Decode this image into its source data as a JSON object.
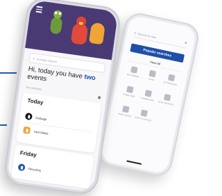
{
  "colors": {
    "accent": "#1f4fa8",
    "hero_bg": "#4a3a74",
    "garbage": "#151515",
    "yard_waste": "#e9a93a",
    "recycling": "#2456b3"
  },
  "back_phone": {
    "search_placeholder": "Search for item",
    "close_icon": "close-icon",
    "popular_searches_label": "Popular searches",
    "view_all_label": "View all",
    "categories": [
      {
        "icon": "batteries-icon",
        "label": "BATTERIES"
      },
      {
        "icon": "paint-icon",
        "label": "PAINT"
      },
      {
        "icon": "styrofoam-icon",
        "label": "STYROFOAM"
      },
      {
        "icon": "furniture-icon",
        "label": "FURNITURE"
      },
      {
        "icon": "cardboard-icon",
        "label": "CARDBOARD"
      },
      {
        "icon": "electronics-icon",
        "label": "ELECTRONICS"
      },
      {
        "icon": "yard-waste-icon",
        "label": "YARD WASTE"
      },
      {
        "icon": "soft-plastics-icon",
        "label": "SOFT PLASTICS"
      }
    ]
  },
  "front_phone": {
    "menu_icon": "menu-icon",
    "search_placeholder": "Example Search",
    "greeting_prefix": "Hi, today you have ",
    "greeting_count": "two",
    "greeting_suffix": "events",
    "schedule_label": "Your Schedule",
    "days": [
      {
        "title": "Today",
        "pickups": [
          {
            "icon": "garbage-icon",
            "label": "Garbage"
          },
          {
            "icon": "yard-waste-icon",
            "label": "Yard Waste"
          }
        ]
      },
      {
        "title": "Friday",
        "pickups": [
          {
            "icon": "recycling-icon",
            "label": "Recycling"
          }
        ]
      }
    ]
  }
}
